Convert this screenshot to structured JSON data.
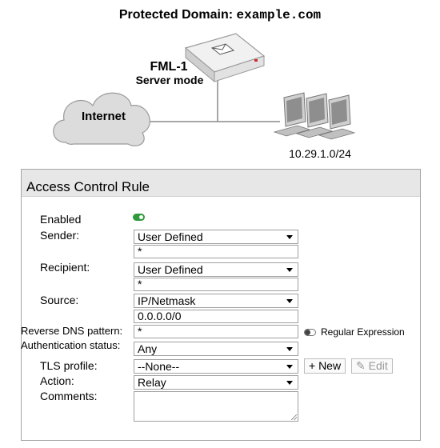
{
  "diagram": {
    "title_prefix": "Protected Domain:",
    "title_domain": "example.com",
    "device_name": "FML-1",
    "device_mode": "Server mode",
    "cloud_label": "Internet",
    "subnet_label": "10.29.1.0/24"
  },
  "panel": {
    "title": "Access Control Rule",
    "enabled_label": "Enabled",
    "enabled": true,
    "sender": {
      "label": "Sender:",
      "type": "User Defined",
      "value": "*"
    },
    "recipient": {
      "label": "Recipient:",
      "type": "User Defined",
      "value": "*"
    },
    "source": {
      "label": "Source:",
      "type": "IP/Netmask",
      "value": "0.0.0.0/0"
    },
    "reverse_dns": {
      "label": "Reverse DNS pattern:",
      "value": "*",
      "regex_label": "Regular Expression",
      "regex_enabled": false
    },
    "auth": {
      "label": "Authentication status:",
      "value": "Any"
    },
    "tls": {
      "label": "TLS profile:",
      "value": "--None--",
      "new_label": "+ New",
      "edit_label": "Edit"
    },
    "action": {
      "label": "Action:",
      "value": "Relay"
    },
    "comments": {
      "label": "Comments:",
      "value": ""
    }
  },
  "colors": {
    "toggle_on": "#2e9a3b",
    "header_bg": "#e7e7e7",
    "border": "#a6a6a6"
  },
  "icons": [
    "router-icon",
    "cloud-icon",
    "workstation-icon",
    "edit-icon"
  ]
}
